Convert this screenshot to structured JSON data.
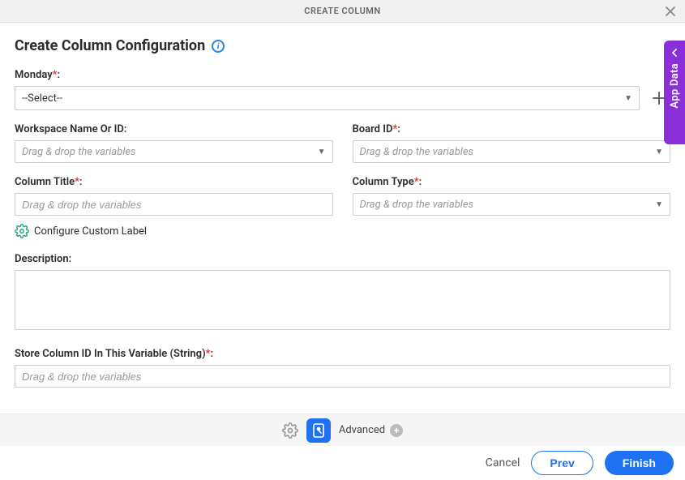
{
  "modal": {
    "title": "CREATE COLUMN"
  },
  "page": {
    "title": "Create Column Configuration"
  },
  "monday": {
    "label": "Monday",
    "colon": ":",
    "selected": "--Select--"
  },
  "workspace": {
    "label": "Workspace Name Or ID:",
    "placeholder": "Drag & drop the variables"
  },
  "board": {
    "label": "Board ID",
    "colon": ":",
    "placeholder": "Drag & drop the variables"
  },
  "columnTitle": {
    "label": "Column Title",
    "colon": ":",
    "placeholder": "Drag & drop the variables"
  },
  "columnType": {
    "label": "Column Type",
    "colon": ":",
    "placeholder": "Drag & drop the variables"
  },
  "customLabel": {
    "text": "Configure Custom Label"
  },
  "description": {
    "label": "Description:"
  },
  "storeVar": {
    "label": "Store Column ID In This Variable (String)",
    "colon": ":",
    "placeholder": "Drag & drop the variables"
  },
  "bottomBar": {
    "advanced": "Advanced"
  },
  "footer": {
    "cancel": "Cancel",
    "prev": "Prev",
    "finish": "Finish"
  },
  "appData": {
    "label": "App Data"
  }
}
